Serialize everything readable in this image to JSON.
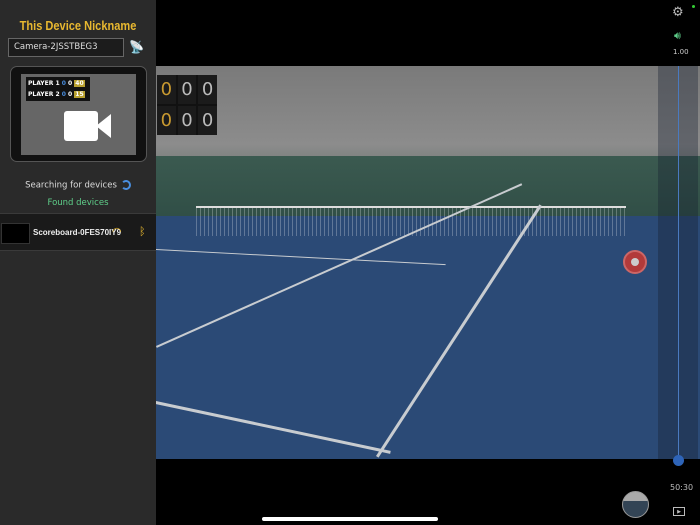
{
  "sidebar": {
    "title": "This Device Nickname",
    "nickname_value": "Camera-2JSSTBEG3",
    "preview": {
      "player1": "PLAYER 1",
      "player2": "PLAYER 2",
      "p1_sets": "0",
      "p1_games": "0",
      "p1_points": "40",
      "p2_sets": "0",
      "p2_games": "0",
      "p2_points": "15"
    },
    "searching": "Searching for devices",
    "found": "Found devices",
    "devices": [
      {
        "name": "Scoreboard-0FES70IY9"
      }
    ]
  },
  "overlay_score": {
    "row1": [
      "0",
      "0",
      "0"
    ],
    "row2": [
      "0",
      "0",
      "0"
    ]
  },
  "controls": {
    "zoom": "1.00",
    "timer": "50:30"
  },
  "colors": {
    "accent": "#e8b830",
    "green": "#5fcf8a",
    "blue": "#4a8fe0",
    "record": "#b23a3a"
  }
}
